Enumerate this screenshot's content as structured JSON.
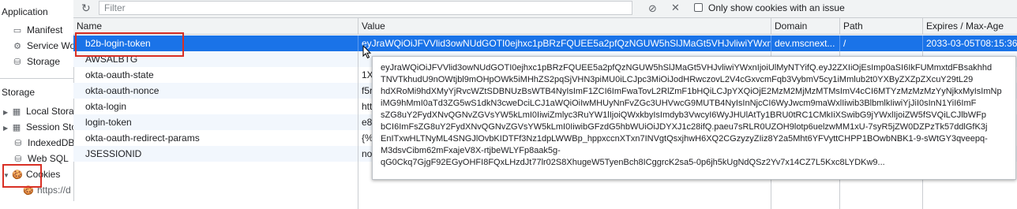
{
  "sidebar": {
    "application_title": "Application",
    "application_items": [
      {
        "label": "Manifest",
        "icon": "manifest-icon"
      },
      {
        "label": "Service Workers",
        "icon": "gear-icon"
      },
      {
        "label": "Storage",
        "icon": "database-icon"
      }
    ],
    "storage_title": "Storage",
    "storage_items": [
      {
        "label": "Local Storage",
        "icon": "grid-icon"
      },
      {
        "label": "Session Storage",
        "icon": "grid-icon"
      },
      {
        "label": "IndexedDB",
        "icon": "database-icon"
      },
      {
        "label": "Web SQL",
        "icon": "database-icon"
      },
      {
        "label": "Cookies",
        "icon": "cookie-icon"
      },
      {
        "label": "https://d",
        "icon": "cookie-icon"
      }
    ]
  },
  "toolbar": {
    "filter_placeholder": "Filter",
    "only_issues_label": "Only show cookies with an issue"
  },
  "table": {
    "columns": [
      "Name",
      "Value",
      "Domain",
      "Path",
      "Expires / Max-Age"
    ],
    "rows": [
      {
        "name": "b2b-login-token",
        "value": "eyJraWQiOiJFVVlid3owNUdGOTI0ejhxc1pBRzFQUEE5a2pfQzNGUW5hSlJMaGt5VHJvliwiYWxnIjoiUlMyNTYifQ",
        "domain": "dev.mscnext...",
        "path": "/",
        "expires": "2033-03-05T08:15:36.",
        "selected": true
      },
      {
        "name": "AWSALBTG",
        "value": "",
        "domain": "",
        "path": "",
        "expires": ""
      },
      {
        "name": "okta-oauth-state",
        "value": "1X",
        "domain": "",
        "path": "",
        "expires": ""
      },
      {
        "name": "okta-oauth-nonce",
        "value": "f5r",
        "domain": "",
        "path": "",
        "expires": ""
      },
      {
        "name": "okta-login",
        "value": "htt",
        "domain": "",
        "path": "",
        "expires": ""
      },
      {
        "name": "login-token",
        "value": "e8",
        "domain": "",
        "path": "",
        "expires": ""
      },
      {
        "name": "okta-oauth-redirect-params",
        "value": "{%",
        "domain": "",
        "path": "",
        "expires": ""
      },
      {
        "name": "JSESSIONID",
        "value": "no",
        "domain": "",
        "path": "",
        "expires": ""
      }
    ]
  },
  "tooltip_lines": [
    "eyJraWQiOiJFVVlid3owNUdGOTI0ejhxc1pBRzFQUEE5a2pfQzNGUW5hSlJMaGt5VHJvliwiYWxnIjoiUlMyNTYifQ.eyJ2ZXIiOjEsImp0aSI6IkFUMmxtdFBsakhhd",
    "TNVTkhudU9nOWtjbl9mOHpOWk5iMHhZS2pqSjVHN3piMU0iLCJpc3MiOiJodHRwczovL2V4cGxvcmFqb3VybmV5cy1iMmlub2t0YXByZXZpZXcuY29tL29",
    "hdXRoMi9hdXMyYjRvcWZtSDBNUzBsWTB4NyIsImF1ZCI6ImFwaTovL2RlZmF1bHQiLCJpYXQiOjE2MzM2MjMzMTMsImV4cCI6MTYzMzMzMzYyNjkxMyIsImNp",
    "iMG9hMmI0aTd3ZG5wS1dkN3cweDciLCJ1aWQiOiIwMHUyNnFvZGc3UHVwcG9MUTB4NyIsInNjcCI6WyJwcm9maWxlIiwib3BlbmlkIiwiYjJiI0sInN1YiI6ImF",
    "sZG8uY2FydXNvQGNvZGVsYW5kLmI0IiwiZmlyc3RuYW1lIjoiQWxkbyIsImdyb3VwcyI6WyJHUlAtTy1BRU0tRC1CMkIiXSwibG9jYWxlIjoiZW5fSVQiLCJlbWFp",
    "bCI6ImFsZG8uY2FydXNvQGNvZGVsYW5kLmI0IiwibGFzdG5hbWUiOiJDYXJ1c28ifQ.paeu7sRLR0UZOH9lotp6uelzwMM1xU-7syR5jZW0DZPzTk57ddlGfK3j",
    "EnITxwHLTNyML4SNGJlOvbKIDTFf3Nz1dpLWWBp_hppxccnXTxn7INVgtQsxjhwH6XQ2CGzyzyZIiz8Y2a5Mht6YFVyttCHPP1BOwbNBK1-9-sWtGY3qveepq-",
    "M3dsvCibm62mFxajeV8X-rtjbeWLYFp8aak5g-",
    "qG0Ckq7GjgF92EGyOHFI8FQxLHzdJt77lr02S8XhugeW5TyenBch8ICggrcK2sa5-0p6jh5kUgNdQSz2Yv7x14CZ7L5Kxc8LYDKw9..."
  ],
  "colors": {
    "selected_row": "#1a73e8",
    "highlight_box": "#d93025"
  }
}
